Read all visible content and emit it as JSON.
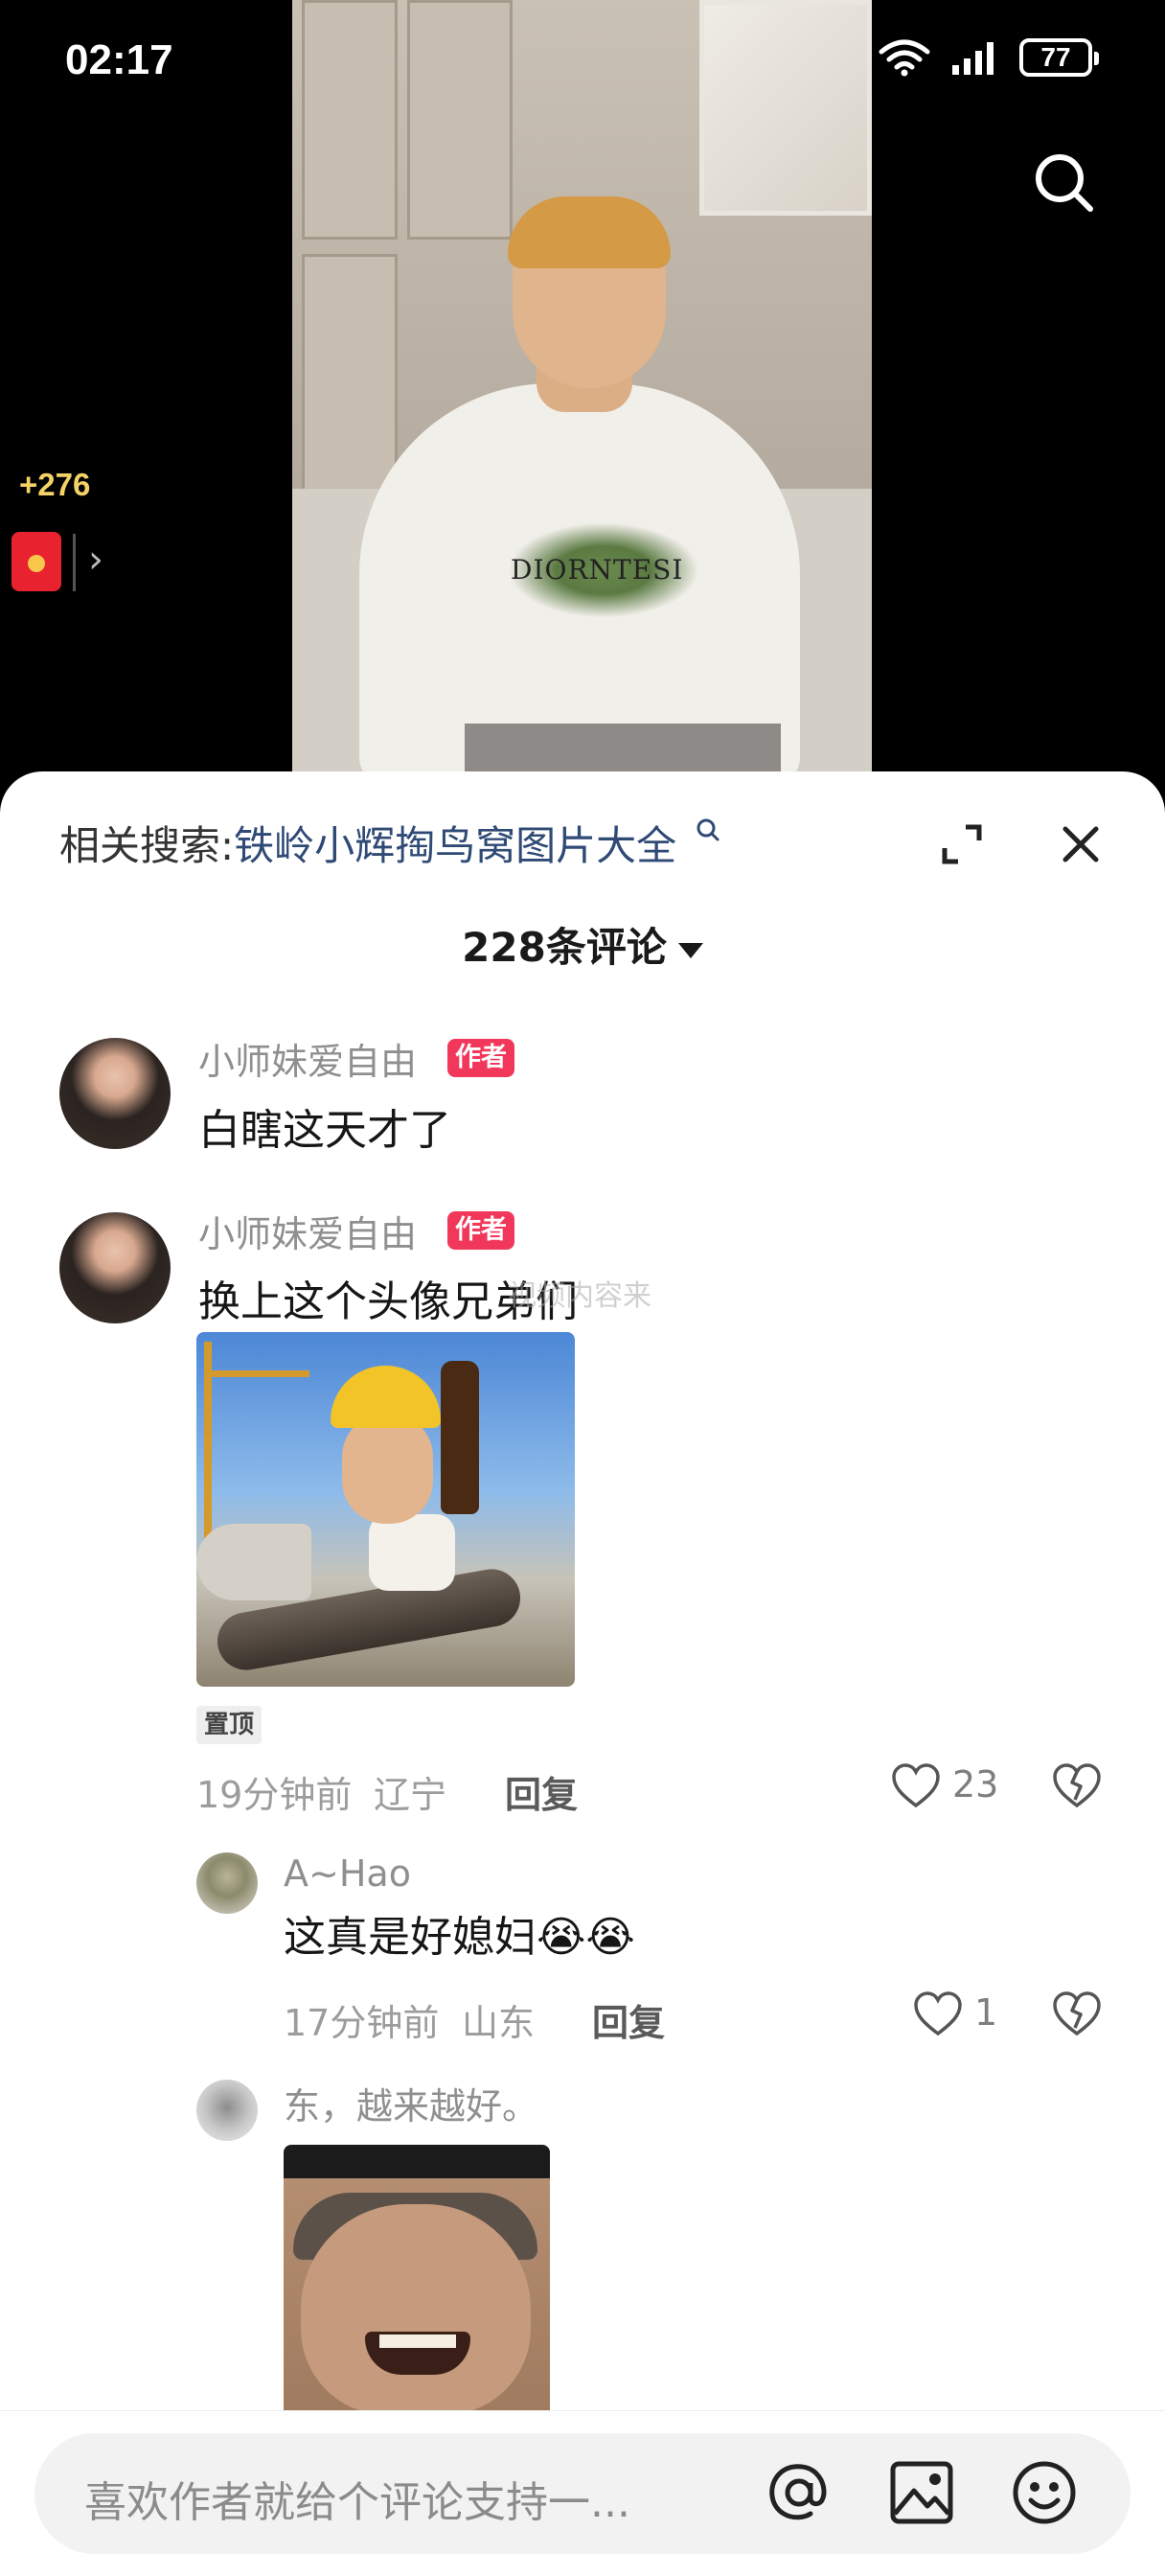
{
  "status_bar": {
    "time": "02:17",
    "battery": "77"
  },
  "video": {
    "shirt_print": "DIORNTESI"
  },
  "reward": {
    "count": "+276"
  },
  "sheet": {
    "related_label": "相关搜索:",
    "related_query": "铁岭小辉掏鸟窝图片大全",
    "comment_count": "228条评论"
  },
  "comments": [
    {
      "username": "小师妹爱自由",
      "badge": "作者",
      "text": "白瞎这天才了"
    },
    {
      "username": "小师妹爱自由",
      "badge": "作者",
      "text": "换上这个头像兄弟们",
      "watermark": "视频内容来",
      "pinned": "置顶",
      "time": "19分钟前",
      "location": "辽宁",
      "reply": "回复",
      "likes": "23"
    }
  ],
  "replies": [
    {
      "username": "A~Hao",
      "text": "这真是好媳妇😭😭",
      "time": "17分钟前",
      "location": "山东",
      "reply": "回复",
      "likes": "1"
    },
    {
      "text": "东，越来越好。"
    }
  ],
  "input": {
    "placeholder": "喜欢作者就给个评论支持一..."
  },
  "colors": {
    "author_badge": "#f2385a",
    "link": "#2f4a75",
    "reward_gold": "#f4d268"
  }
}
